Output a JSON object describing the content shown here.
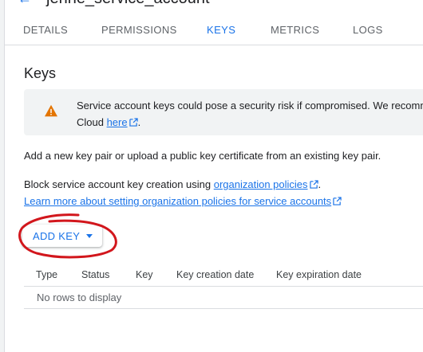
{
  "header": {
    "back_icon": "back-arrow-icon",
    "title": "jenne_service_account"
  },
  "tabs": [
    {
      "label": "DETAILS",
      "active": false
    },
    {
      "label": "PERMISSIONS",
      "active": false
    },
    {
      "label": "KEYS",
      "active": true
    },
    {
      "label": "METRICS",
      "active": false
    },
    {
      "label": "LOGS",
      "active": false
    }
  ],
  "keys_section": {
    "title": "Keys",
    "warning": {
      "icon": "warning-icon",
      "line1": "Service account keys could pose a security risk if compromised. We recomm",
      "line2_prefix": "Cloud ",
      "link": "here",
      "line2_suffix": "."
    },
    "intro": "Add a new key pair or upload a public key certificate from an existing key pair.",
    "policy_prefix": "Block service account key creation using ",
    "policy_link": "organization policies",
    "policy_suffix": ".",
    "learn_more_link": "Learn more about setting organization policies for service accounts",
    "add_key_label": "ADD KEY"
  },
  "table": {
    "columns": [
      "Type",
      "Status",
      "Key",
      "Key creation date",
      "Key expiration date"
    ],
    "empty_text": "No rows to display"
  },
  "colors": {
    "accent": "#1a73e8",
    "warning": "#e37400",
    "annotation": "#d2161c"
  }
}
